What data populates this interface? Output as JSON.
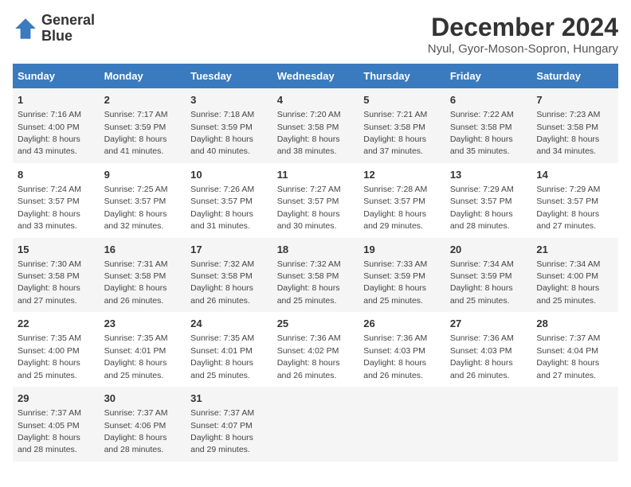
{
  "logo": {
    "line1": "General",
    "line2": "Blue"
  },
  "title": "December 2024",
  "subtitle": "Nyul, Gyor-Moson-Sopron, Hungary",
  "days_of_week": [
    "Sunday",
    "Monday",
    "Tuesday",
    "Wednesday",
    "Thursday",
    "Friday",
    "Saturday"
  ],
  "weeks": [
    [
      {
        "day": "1",
        "sunrise": "7:16 AM",
        "sunset": "4:00 PM",
        "daylight": "8 hours and 43 minutes."
      },
      {
        "day": "2",
        "sunrise": "7:17 AM",
        "sunset": "3:59 PM",
        "daylight": "8 hours and 41 minutes."
      },
      {
        "day": "3",
        "sunrise": "7:18 AM",
        "sunset": "3:59 PM",
        "daylight": "8 hours and 40 minutes."
      },
      {
        "day": "4",
        "sunrise": "7:20 AM",
        "sunset": "3:58 PM",
        "daylight": "8 hours and 38 minutes."
      },
      {
        "day": "5",
        "sunrise": "7:21 AM",
        "sunset": "3:58 PM",
        "daylight": "8 hours and 37 minutes."
      },
      {
        "day": "6",
        "sunrise": "7:22 AM",
        "sunset": "3:58 PM",
        "daylight": "8 hours and 35 minutes."
      },
      {
        "day": "7",
        "sunrise": "7:23 AM",
        "sunset": "3:58 PM",
        "daylight": "8 hours and 34 minutes."
      }
    ],
    [
      {
        "day": "8",
        "sunrise": "7:24 AM",
        "sunset": "3:57 PM",
        "daylight": "8 hours and 33 minutes."
      },
      {
        "day": "9",
        "sunrise": "7:25 AM",
        "sunset": "3:57 PM",
        "daylight": "8 hours and 32 minutes."
      },
      {
        "day": "10",
        "sunrise": "7:26 AM",
        "sunset": "3:57 PM",
        "daylight": "8 hours and 31 minutes."
      },
      {
        "day": "11",
        "sunrise": "7:27 AM",
        "sunset": "3:57 PM",
        "daylight": "8 hours and 30 minutes."
      },
      {
        "day": "12",
        "sunrise": "7:28 AM",
        "sunset": "3:57 PM",
        "daylight": "8 hours and 29 minutes."
      },
      {
        "day": "13",
        "sunrise": "7:29 AM",
        "sunset": "3:57 PM",
        "daylight": "8 hours and 28 minutes."
      },
      {
        "day": "14",
        "sunrise": "7:29 AM",
        "sunset": "3:57 PM",
        "daylight": "8 hours and 27 minutes."
      }
    ],
    [
      {
        "day": "15",
        "sunrise": "7:30 AM",
        "sunset": "3:58 PM",
        "daylight": "8 hours and 27 minutes."
      },
      {
        "day": "16",
        "sunrise": "7:31 AM",
        "sunset": "3:58 PM",
        "daylight": "8 hours and 26 minutes."
      },
      {
        "day": "17",
        "sunrise": "7:32 AM",
        "sunset": "3:58 PM",
        "daylight": "8 hours and 26 minutes."
      },
      {
        "day": "18",
        "sunrise": "7:32 AM",
        "sunset": "3:58 PM",
        "daylight": "8 hours and 25 minutes."
      },
      {
        "day": "19",
        "sunrise": "7:33 AM",
        "sunset": "3:59 PM",
        "daylight": "8 hours and 25 minutes."
      },
      {
        "day": "20",
        "sunrise": "7:34 AM",
        "sunset": "3:59 PM",
        "daylight": "8 hours and 25 minutes."
      },
      {
        "day": "21",
        "sunrise": "7:34 AM",
        "sunset": "4:00 PM",
        "daylight": "8 hours and 25 minutes."
      }
    ],
    [
      {
        "day": "22",
        "sunrise": "7:35 AM",
        "sunset": "4:00 PM",
        "daylight": "8 hours and 25 minutes."
      },
      {
        "day": "23",
        "sunrise": "7:35 AM",
        "sunset": "4:01 PM",
        "daylight": "8 hours and 25 minutes."
      },
      {
        "day": "24",
        "sunrise": "7:35 AM",
        "sunset": "4:01 PM",
        "daylight": "8 hours and 25 minutes."
      },
      {
        "day": "25",
        "sunrise": "7:36 AM",
        "sunset": "4:02 PM",
        "daylight": "8 hours and 26 minutes."
      },
      {
        "day": "26",
        "sunrise": "7:36 AM",
        "sunset": "4:03 PM",
        "daylight": "8 hours and 26 minutes."
      },
      {
        "day": "27",
        "sunrise": "7:36 AM",
        "sunset": "4:03 PM",
        "daylight": "8 hours and 26 minutes."
      },
      {
        "day": "28",
        "sunrise": "7:37 AM",
        "sunset": "4:04 PM",
        "daylight": "8 hours and 27 minutes."
      }
    ],
    [
      {
        "day": "29",
        "sunrise": "7:37 AM",
        "sunset": "4:05 PM",
        "daylight": "8 hours and 28 minutes."
      },
      {
        "day": "30",
        "sunrise": "7:37 AM",
        "sunset": "4:06 PM",
        "daylight": "8 hours and 28 minutes."
      },
      {
        "day": "31",
        "sunrise": "7:37 AM",
        "sunset": "4:07 PM",
        "daylight": "8 hours and 29 minutes."
      },
      null,
      null,
      null,
      null
    ]
  ]
}
